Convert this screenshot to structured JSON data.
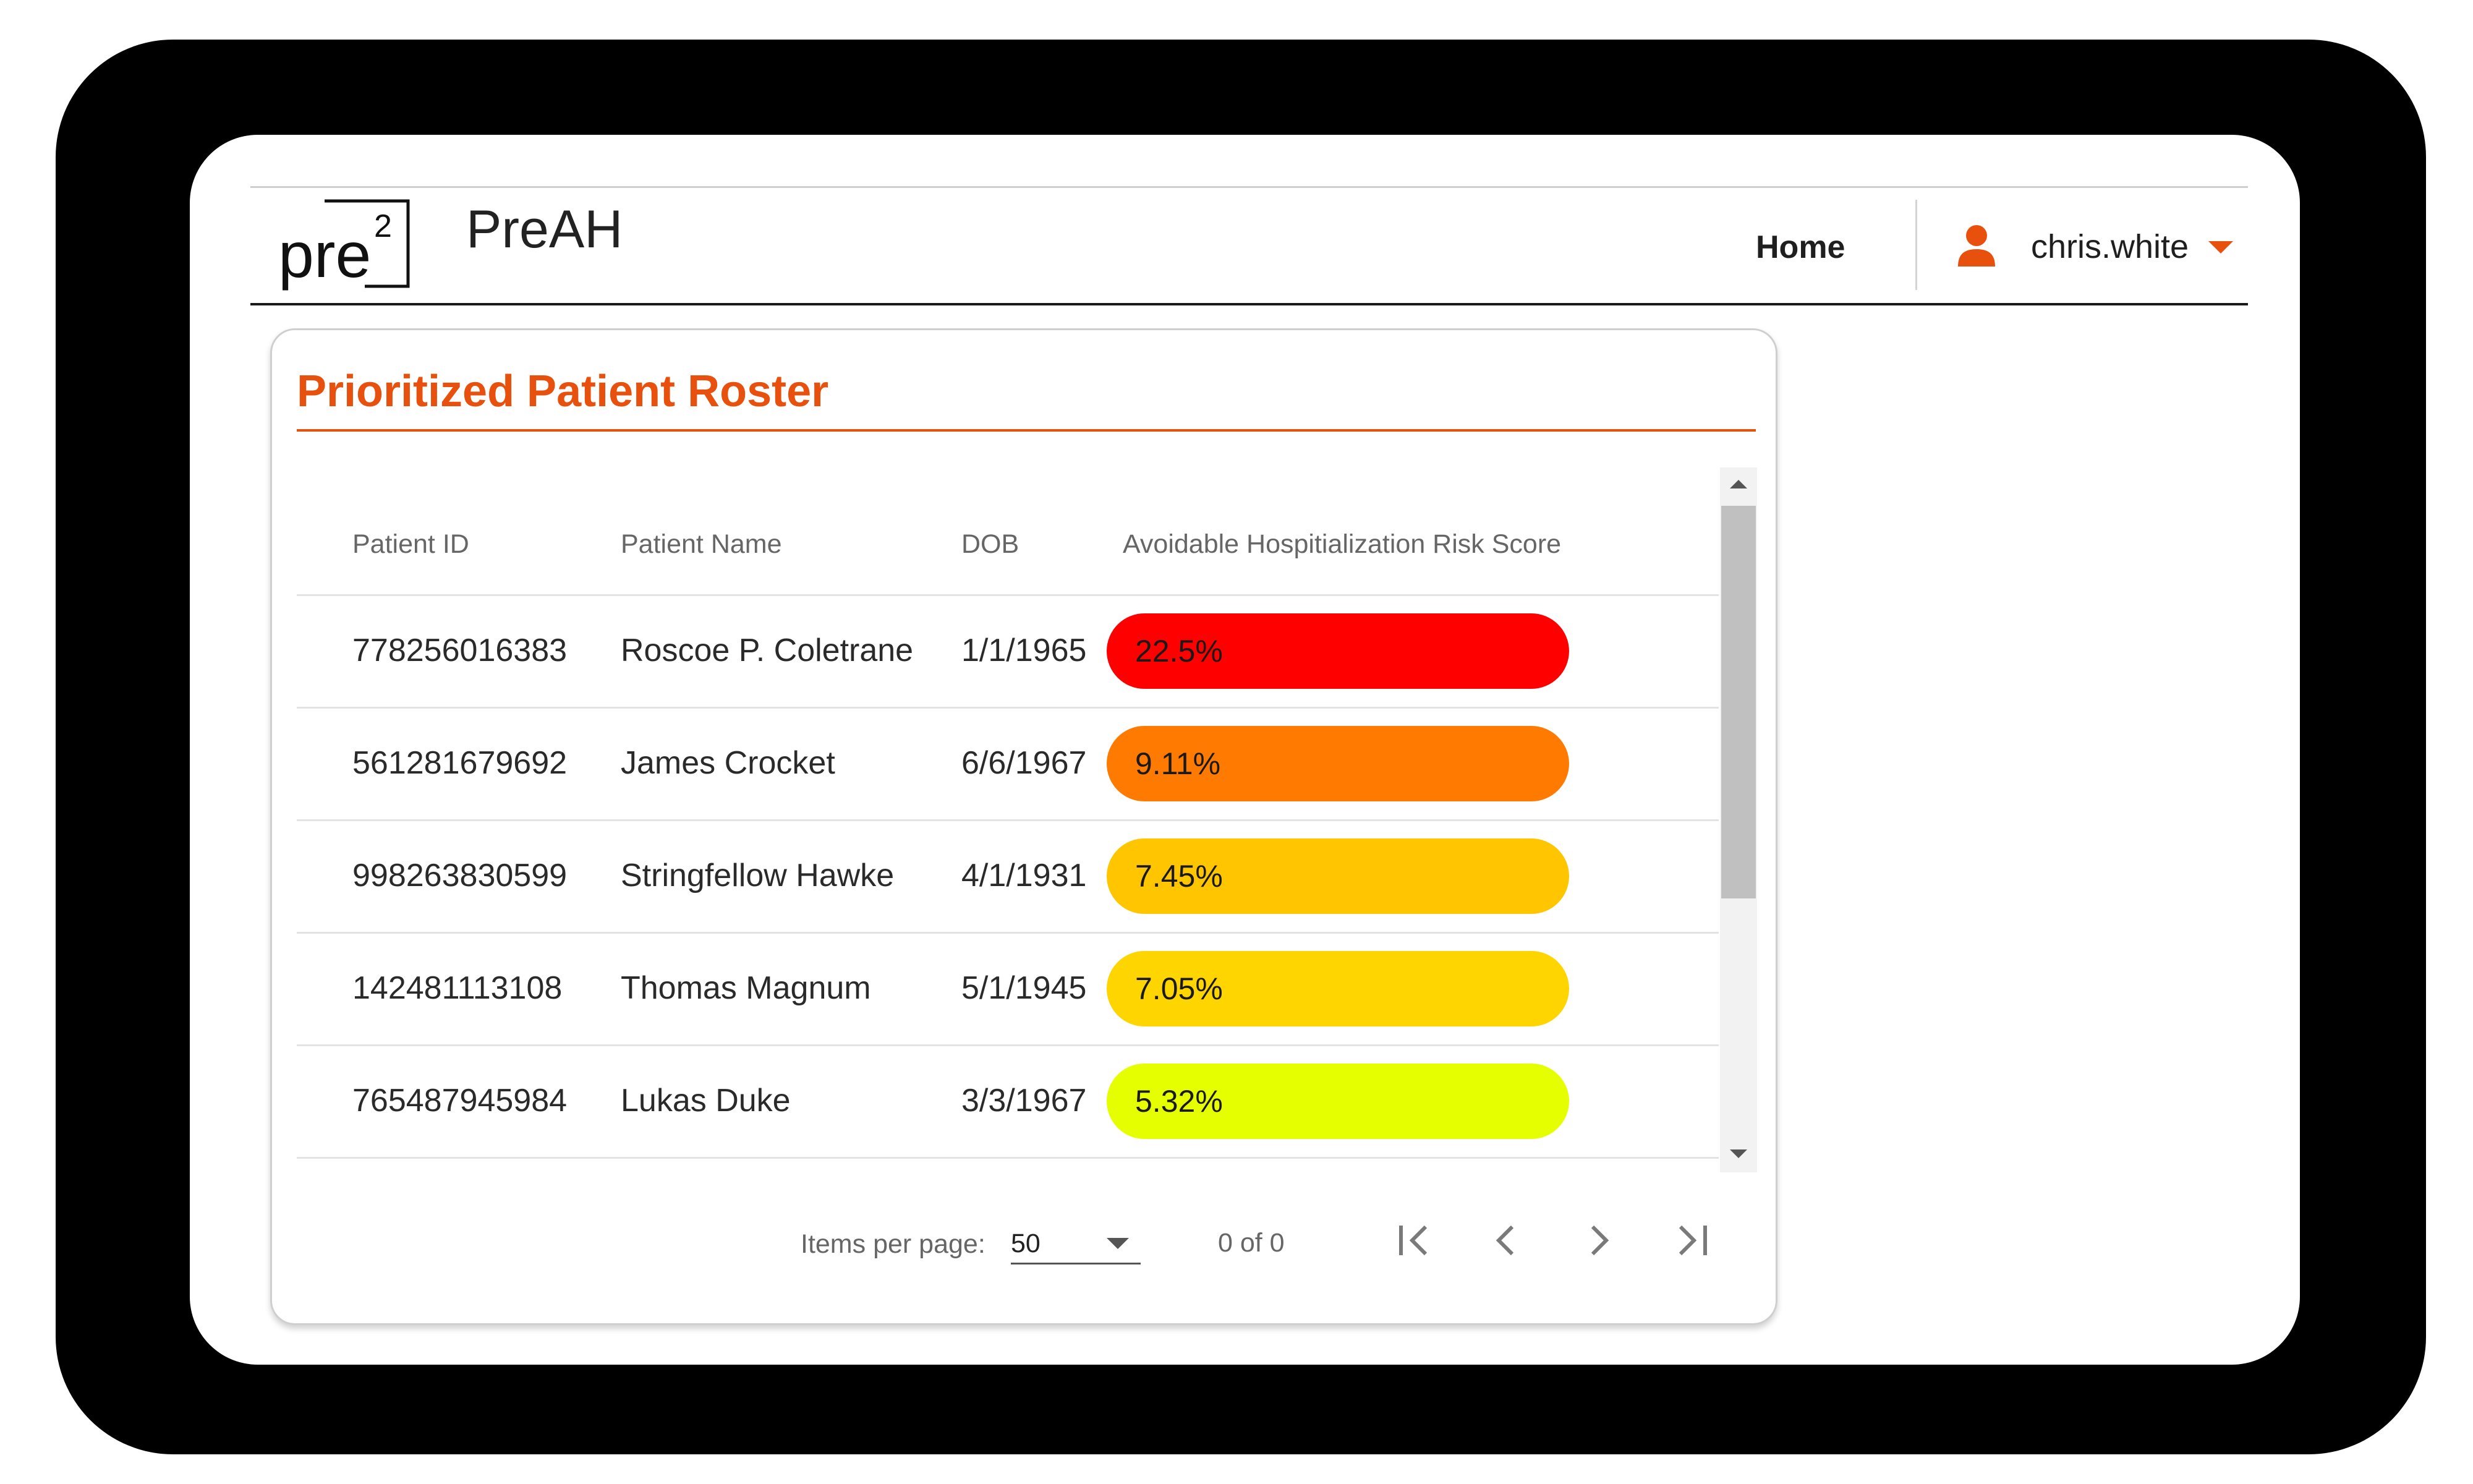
{
  "header": {
    "logo_text": "pre",
    "logo_superscript": "2",
    "app_title": "PreAH",
    "nav_home": "Home",
    "user_icon": "person-icon",
    "username": "chris.white",
    "accent_color": "#e8500e"
  },
  "roster": {
    "title": "Prioritized Patient Roster",
    "columns": [
      "Patient ID",
      "Patient Name",
      "DOB",
      "Avoidable Hospitialization Risk Score"
    ],
    "rows": [
      {
        "id": "778256016383",
        "name": "Roscoe P. Coletrane",
        "dob": "1/1/1965",
        "score": "22.5%",
        "color": "#ff0000"
      },
      {
        "id": "561281679692",
        "name": "James Crocket",
        "dob": "6/6/1967",
        "score": "9.11%",
        "color": "#ff7a00"
      },
      {
        "id": "998263830599",
        "name": "Stringfellow Hawke",
        "dob": "4/1/1931",
        "score": "7.45%",
        "color": "#ffc600"
      },
      {
        "id": "142481113108",
        "name": "Thomas Magnum",
        "dob": "5/1/1945",
        "score": "7.05%",
        "color": "#ffd500"
      },
      {
        "id": "765487945984",
        "name": "Lukas Duke",
        "dob": "3/3/1967",
        "score": "5.32%",
        "color": "#e5ff00"
      }
    ]
  },
  "paginator": {
    "items_label": "Items per page:",
    "page_size": "50",
    "range_label": "0 of 0",
    "icons": [
      "first-page-icon",
      "previous-page-icon",
      "next-page-icon",
      "last-page-icon"
    ]
  }
}
